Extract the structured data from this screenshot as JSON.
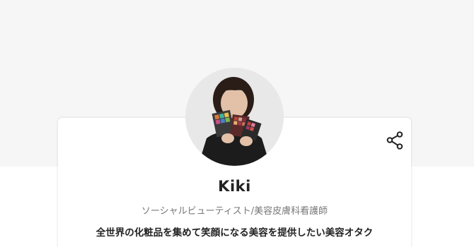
{
  "profile": {
    "name": "Kiki",
    "role": "ソーシャルビューティスト/美容皮膚科看護師",
    "bio": "全世界の化粧品を集めて笑顔になる美容を提供したい美容オタク"
  },
  "icons": {
    "share": "share-icon"
  },
  "colors": {
    "cover_bg": "#f6f6f6",
    "card_bg": "#ffffff",
    "name_text": "#222222",
    "role_text": "#777777"
  }
}
